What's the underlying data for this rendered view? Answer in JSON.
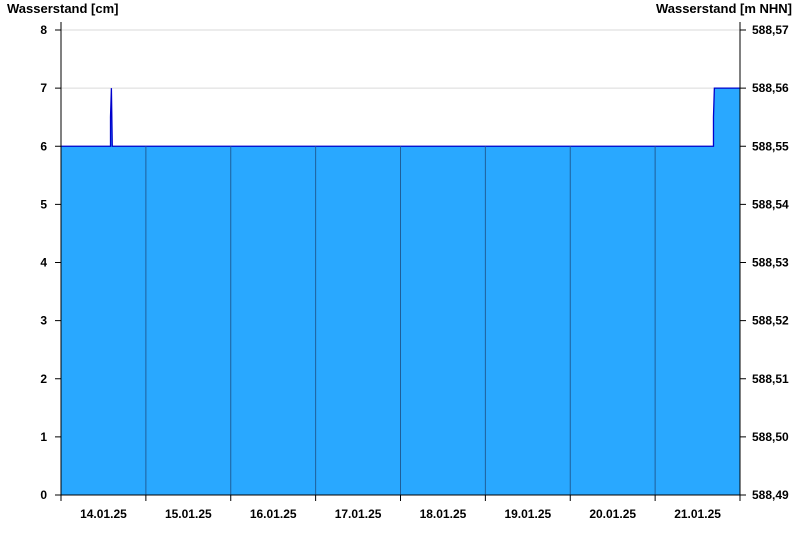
{
  "chart_data": {
    "type": "area",
    "ylabel_left": "Wasserstand [cm]",
    "ylabel_right": "Wasserstand [m NHN]",
    "y_left_ticks": [
      "0",
      "1",
      "2",
      "3",
      "4",
      "5",
      "6",
      "7",
      "8"
    ],
    "y_right_ticks": [
      "588,49",
      "588,50",
      "588,51",
      "588,52",
      "588,53",
      "588,54",
      "588,55",
      "588,56",
      "588,57"
    ],
    "ylim": [
      0,
      8
    ],
    "xlim": [
      "13.01.25 00:00",
      "21.01.25 00:00"
    ],
    "x_ticks": [
      "14.01.25",
      "15.01.25",
      "16.01.25",
      "17.01.25",
      "18.01.25",
      "19.01.25",
      "20.01.25",
      "21.01.25"
    ],
    "grid": "horizontal",
    "series": [
      {
        "values": [
          {
            "x": "13.01.25 00:00",
            "y": 6
          },
          {
            "x": "13.01.25 14:00",
            "y": 6
          },
          {
            "x": "13.01.25 14:00",
            "y": 6.5
          },
          {
            "x": "13.01.25 14:15",
            "y": 7
          },
          {
            "x": "13.01.25 14:30",
            "y": 6
          },
          {
            "x": "20.01.25 16:30",
            "y": 6
          },
          {
            "x": "20.01.25 16:30",
            "y": 6.5
          },
          {
            "x": "20.01.25 16:45",
            "y": 7
          },
          {
            "x": "21.01.25 00:00",
            "y": 7
          }
        ]
      }
    ],
    "colors": {
      "fill": "#29A8FF",
      "line": "#0000CC",
      "day_separator": "#1F5F9A",
      "grid": "#DADADA",
      "axis": "#000000"
    }
  }
}
